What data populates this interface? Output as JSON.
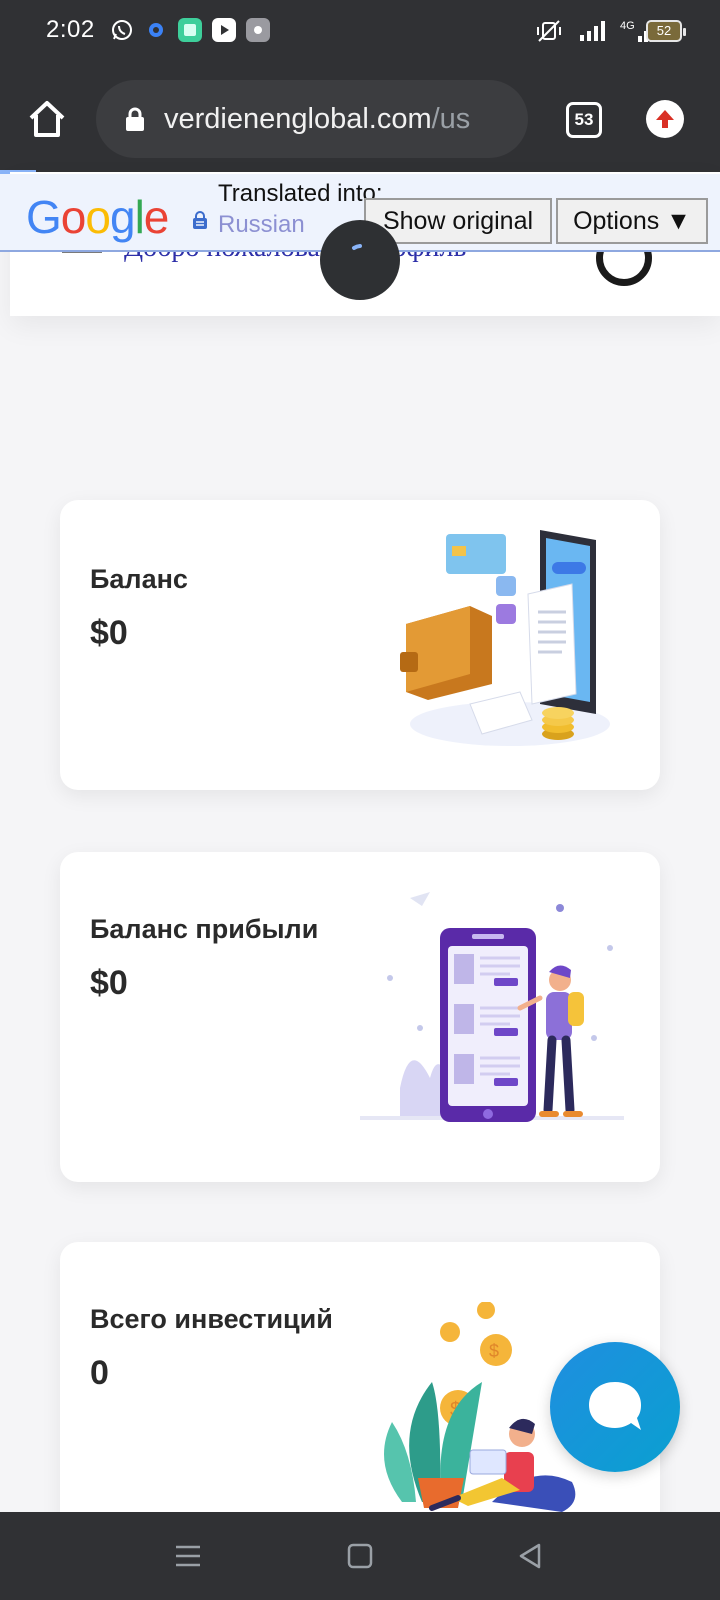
{
  "status_bar": {
    "time": "2:02",
    "battery": "52",
    "network": "4G",
    "app_icons": [
      "whatsapp-icon",
      "settings-icon",
      "gallery-icon",
      "youtube-icon",
      "app-icon"
    ]
  },
  "browser": {
    "url_host": "verdienenglobal.com",
    "url_path": "/us",
    "tab_count": "53"
  },
  "translate_bar": {
    "logo": "Google",
    "translated_into": "Translated into:",
    "language": "Russian",
    "show_original": "Show original",
    "options": "Options ▼"
  },
  "page_header": {
    "welcome_text": "Добро пожаловать, Профиль"
  },
  "cards": [
    {
      "label": "Баланс",
      "value": "$0"
    },
    {
      "label": "Баланс прибыли",
      "value": "$0"
    },
    {
      "label": "Всего инвестиций",
      "value": "0"
    }
  ],
  "colors": {
    "chrome_dark": "#303134",
    "chat_accent": "#1a93de",
    "card_text": "#2a2a2a",
    "header_link": "#2d2fa8"
  }
}
